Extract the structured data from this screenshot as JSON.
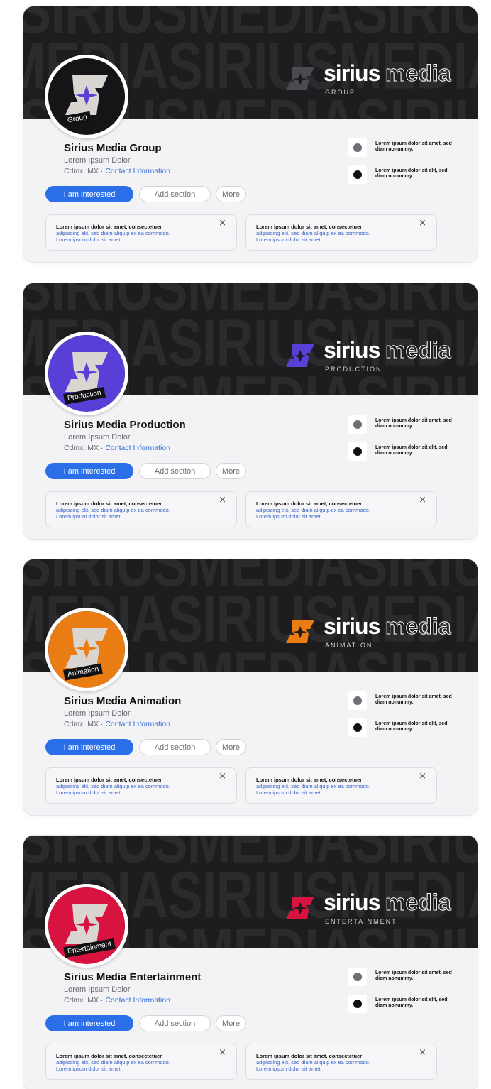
{
  "cards": [
    {
      "accent": "#4a4a50",
      "avatar_bg": "#151518",
      "avatar_tag": "Group",
      "logo": {
        "sirius": "sirius",
        "media": "media",
        "sub": "GROUP"
      },
      "name": "Sirius Media Group",
      "tagline": "Lorem Ipsum Dolor",
      "location": "Cdmx. MX ·",
      "contact": "Contact Information",
      "buttons": {
        "primary": "I am interested",
        "secondary": "Add section",
        "more": "More"
      },
      "side_items": [
        {
          "text": "Lorem ipsum dolor sit amet, sed diam nonummy."
        },
        {
          "text": "Lorem ipsum dolor sit elit, sed diam nonummy."
        }
      ],
      "notes": [
        {
          "line1": "Lorem ipsum dolor sit amet, consectetuer",
          "line2": "adipiscing elit, sed diam aliquip ex ea commodo.",
          "line3": "Lorem ipsum dolor sit amet.",
          "close": "×"
        },
        {
          "line1": "Lorem ipsum dolor sit amet, consectetuer",
          "line2": "adipiscing elit, sed diam aliquip ex ea commodo.",
          "line3": "Lorem ipsum dolor sit amet.",
          "close": "×"
        }
      ]
    },
    {
      "accent": "#5a3fd6",
      "avatar_bg": "#5a3fd6",
      "avatar_tag": "Production",
      "logo": {
        "sirius": "sirius",
        "media": "media",
        "sub": "PRODUCTION"
      },
      "name": "Sirius Media Production",
      "tagline": "Lorem Ipsum Dolor",
      "location": "Cdmx. MX ·",
      "contact": "Contact Information",
      "buttons": {
        "primary": "I am interested",
        "secondary": "Add section",
        "more": "More"
      },
      "side_items": [
        {
          "text": "Lorem ipsum dolor sit amet, sed diam nonummy."
        },
        {
          "text": "Lorem ipsum dolor sit elit, sed diam nonummy."
        }
      ],
      "notes": [
        {
          "line1": "Lorem ipsum dolor sit amet, consectetuer",
          "line2": "adipiscing elit, sed diam aliquip ex ea commodo.",
          "line3": "Lorem ipsum dolor sit amet.",
          "close": "×"
        },
        {
          "line1": "Lorem ipsum dolor sit amet, consectetuer",
          "line2": "adipiscing elit, sed diam aliquip ex ea commodo.",
          "line3": "Lorem ipsum dolor sit amet.",
          "close": "×"
        }
      ]
    },
    {
      "accent": "#e97c12",
      "avatar_bg": "#e97c12",
      "avatar_tag": "Animation",
      "logo": {
        "sirius": "sirius",
        "media": "media",
        "sub": "ANIMATION"
      },
      "name": "Sirius Media Animation",
      "tagline": "Lorem Ipsum Dolor",
      "location": "Cdmx. MX ·",
      "contact": "Contact Information",
      "buttons": {
        "primary": "I am interested",
        "secondary": "Add section",
        "more": "More"
      },
      "side_items": [
        {
          "text": "Lorem ipsum dolor sit amet, sed diam nonummy."
        },
        {
          "text": "Lorem ipsum dolor sit elit, sed diam nonummy."
        }
      ],
      "notes": [
        {
          "line1": "Lorem ipsum dolor sit amet, consectetuer",
          "line2": "adipiscing elit, sed diam aliquip ex ea commodo.",
          "line3": "Lorem ipsum dolor sit amet.",
          "close": "×"
        },
        {
          "line1": "Lorem ipsum dolor sit amet, consectetuer",
          "line2": "adipiscing elit, sed diam aliquip ex ea commodo.",
          "line3": "Lorem ipsum dolor sit amet.",
          "close": "×"
        }
      ]
    },
    {
      "accent": "#d8133f",
      "avatar_bg": "#d8133f",
      "avatar_tag": "Entertainment",
      "logo": {
        "sirius": "sirius",
        "media": "media",
        "sub": "ENTERTAINMENT"
      },
      "name": "Sirius Media Entertainment",
      "tagline": "Lorem Ipsum Dolor",
      "location": "Cdmx. MX ·",
      "contact": "Contact Information",
      "buttons": {
        "primary": "I am interested",
        "secondary": "Add section",
        "more": "More"
      },
      "side_items": [
        {
          "text": "Lorem ipsum dolor sit amet, sed diam nonummy."
        },
        {
          "text": "Lorem ipsum dolor sit elit, sed diam nonummy."
        }
      ],
      "notes": [
        {
          "line1": "Lorem ipsum dolor sit amet, consectetuer",
          "line2": "adipiscing elit, sed diam aliquip ex ea commodo.",
          "line3": "Lorem ipsum dolor sit amet.",
          "close": "×"
        },
        {
          "line1": "Lorem ipsum dolor sit amet, consectetuer",
          "line2": "adipiscing elit, sed diam aliquip ex ea commodo.",
          "line3": "Lorem ipsum dolor sit amet.",
          "close": "×"
        }
      ]
    }
  ],
  "banner_words": {
    "row1": "SIRIUSMEDIASIRIUS",
    "row2": "MEDIASIRIUSMEDIA",
    "row3": "SIRIUSMEDIASIRIUS"
  }
}
